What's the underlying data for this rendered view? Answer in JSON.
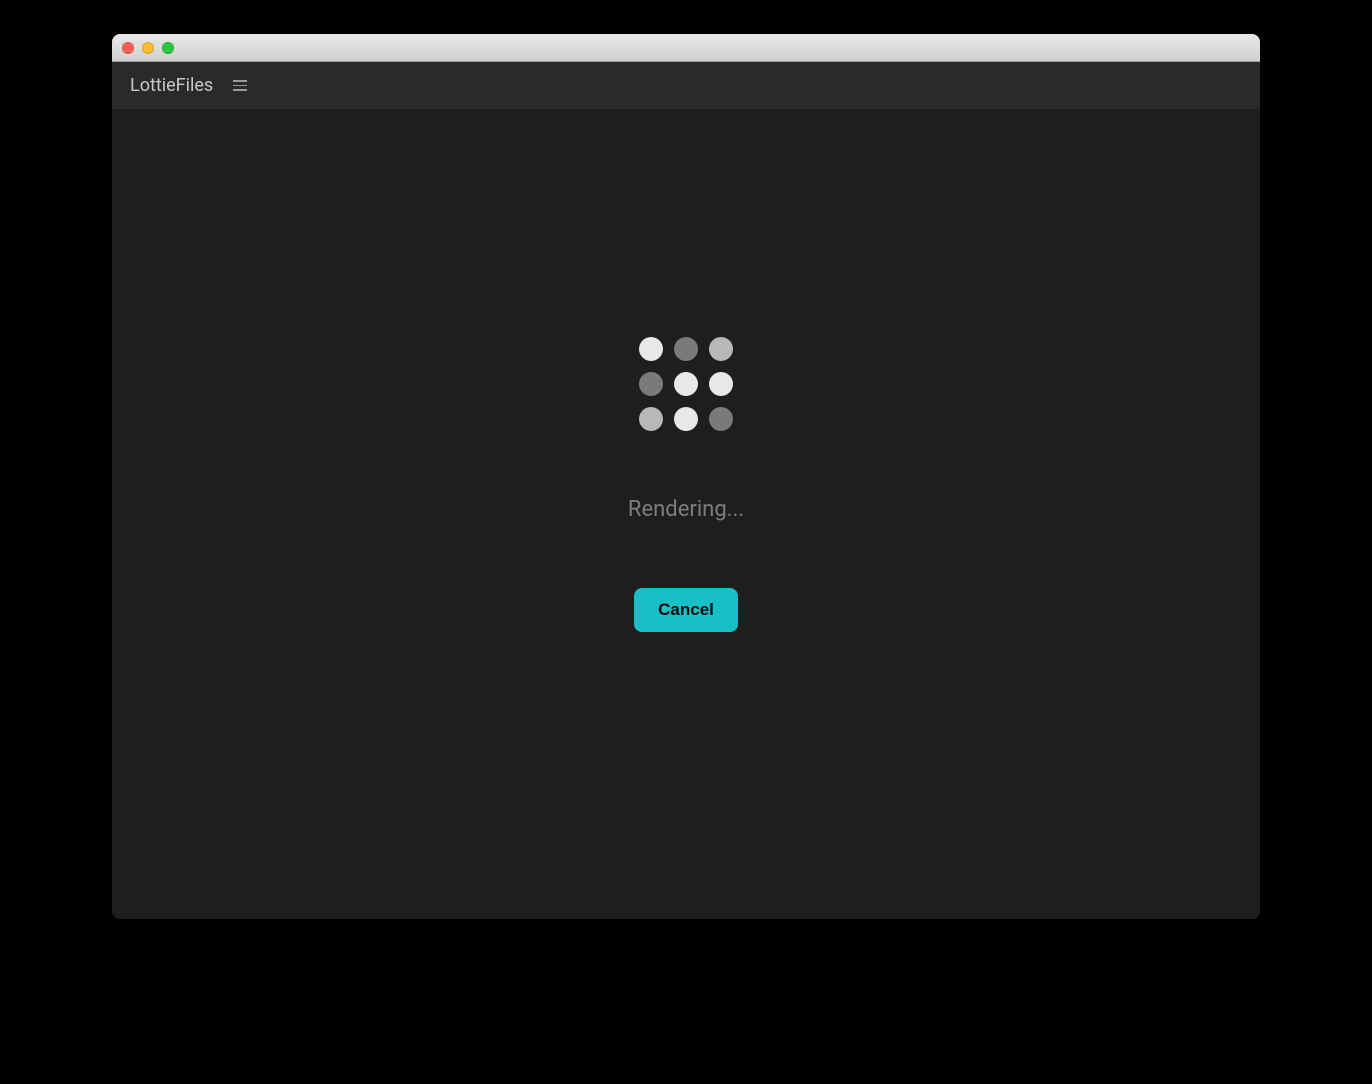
{
  "header": {
    "app_title": "LottieFiles"
  },
  "main": {
    "status_text": "Rendering...",
    "cancel_label": "Cancel"
  },
  "colors": {
    "accent": "#18c1c7",
    "background": "#1e1e1e",
    "toolbar": "#2a2a2a"
  },
  "loader": {
    "dots": [
      "bright",
      "dim",
      "mid",
      "dim",
      "bright",
      "bright",
      "mid",
      "bright",
      "dim"
    ]
  }
}
